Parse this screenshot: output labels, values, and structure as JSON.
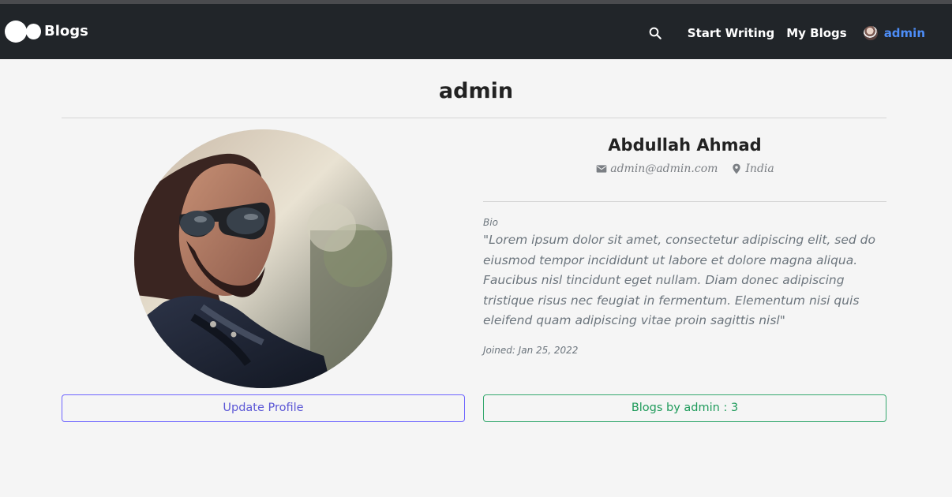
{
  "navbar": {
    "brand": "Blogs",
    "links": {
      "start_writing": "Start Writing",
      "my_blogs": "My Blogs"
    },
    "user": "admin"
  },
  "profile": {
    "page_title": "admin",
    "name": "Abdullah Ahmad",
    "email": "admin@admin.com",
    "location": "India",
    "bio_label": "Bio",
    "bio": "\"Lorem ipsum dolor sit amet, consectetur adipiscing elit, sed do eiusmod tempor incididunt ut labore et dolore magna aliqua. Faucibus nisl tincidunt eget nullam. Diam donec adipiscing tristique risus nec feugiat in fermentum. Elementum nisi quis eleifend quam adipiscing vitae proin sagittis nisl\"",
    "joined": "Joined: Jan 25, 2022"
  },
  "actions": {
    "update_profile": "Update Profile",
    "blogs_by_admin": "Blogs by admin : 3"
  },
  "colors": {
    "navbar": "#212529",
    "accent_user": "#4d8df7",
    "update_button": "#5b57d6",
    "blogs_button": "#1f9b5b"
  },
  "icons": {
    "brand": "double-circle-logo",
    "search": "search-icon",
    "email": "envelope-icon",
    "location": "map-pin-icon"
  }
}
